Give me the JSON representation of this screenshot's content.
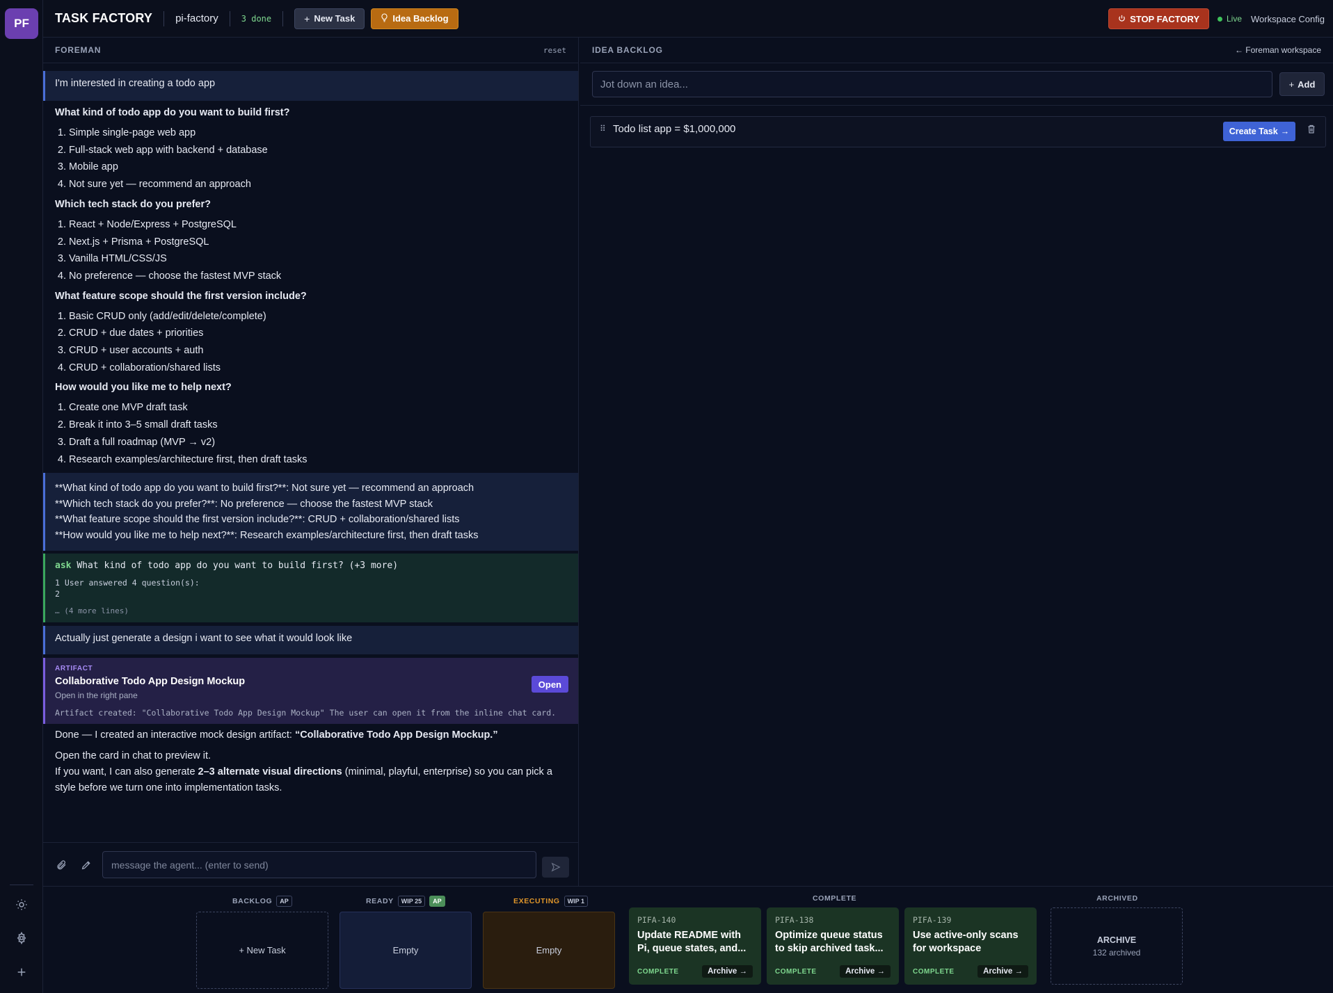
{
  "rail": {
    "avatar": "PF",
    "icons": [
      "sun-icon",
      "gear-icon",
      "plus-icon"
    ]
  },
  "header": {
    "brand": "TASK FACTORY",
    "project": "pi-factory",
    "done": "3 done",
    "new_task": "New Task",
    "idea_backlog": "Idea Backlog",
    "stop": "STOP FACTORY",
    "live": "Live",
    "workspace_config": "Workspace Config"
  },
  "foreman": {
    "title": "FOREMAN",
    "reset": "reset",
    "user_msg_1": "I'm interested in creating a todo app",
    "questions": [
      {
        "q": "What kind of todo app do you want to build first?",
        "opts": [
          "Simple single-page web app",
          "Full-stack web app with backend + database",
          "Mobile app",
          "Not sure yet — recommend an approach"
        ]
      },
      {
        "q": "Which tech stack do you prefer?",
        "opts": [
          "React + Node/Express + PostgreSQL",
          "Next.js + Prisma + PostgreSQL",
          "Vanilla HTML/CSS/JS",
          "No preference — choose the fastest MVP stack"
        ]
      },
      {
        "q": "What feature scope should the first version include?",
        "opts": [
          "Basic CRUD only (add/edit/delete/complete)",
          "CRUD + due dates + priorities",
          "CRUD + user accounts + auth",
          "CRUD + collaboration/shared lists"
        ]
      },
      {
        "q": "How would you like me to help next?",
        "opts": [
          "Create one MVP draft task",
          "Break it into 3–5 small draft tasks",
          "Draft a full roadmap (MVP → v2)",
          "Research examples/architecture first, then draft tasks"
        ]
      }
    ],
    "answers": [
      "**What kind of todo app do you want to build first?**: Not sure yet — recommend an approach",
      "**Which tech stack do you prefer?**: No preference — choose the fastest MVP stack",
      "**What feature scope should the first version include?**: CRUD + collaboration/shared lists",
      "**How would you like me to help next?**: Research examples/architecture first, then draft tasks"
    ],
    "tool": {
      "name": "ask",
      "summary": "What kind of todo app do you want to build first? (+3 more)",
      "line1": "1  User answered 4 question(s):",
      "line2": "2",
      "more": "… (4 more lines)"
    },
    "user_msg_2": "Actually just generate a design i want to see what it would look like",
    "artifact": {
      "label": "ARTIFACT",
      "title": "Collaborative Todo App Design Mockup",
      "sub": "Open in the right pane",
      "open": "Open",
      "log": "Artifact created: \"Collaborative Todo App Design Mockup\" The user can open it from the inline chat card."
    },
    "final": {
      "p1_prefix": "Done — I created an interactive mock design artifact: ",
      "p1_bold": "“Collaborative Todo App Design Mockup.”",
      "p2": "Open the card in chat to preview it.",
      "p3_prefix": "If you want, I can also generate ",
      "p3_bold": "2–3 alternate visual directions",
      "p3_suffix": " (minimal, playful, enterprise) so you can pick a style before we turn one into implementation tasks."
    },
    "composer_placeholder": "message the agent... (enter to send)"
  },
  "ideas": {
    "title": "IDEA BACKLOG",
    "back": "Foreman workspace",
    "input_placeholder": "Jot down an idea...",
    "add": "Add",
    "items": [
      {
        "text": "Todo list app = $1,000,000",
        "create": "Create Task"
      }
    ]
  },
  "board": {
    "backlog": {
      "label": "BACKLOG",
      "tag": "AP",
      "slot": "+ New Task"
    },
    "ready": {
      "label": "READY",
      "tag1": "WIP 25",
      "tag2": "AP",
      "slot": "Empty"
    },
    "executing": {
      "label": "EXECUTING",
      "tag": "WIP 1",
      "slot": "Empty"
    },
    "complete": {
      "label": "COMPLETE",
      "cards": [
        {
          "id": "PIFA-140",
          "title": "Update README with Pi, queue states, and...",
          "status": "COMPLETE",
          "action": "Archive"
        },
        {
          "id": "PIFA-138",
          "title": "Optimize queue status to skip archived task...",
          "status": "COMPLETE",
          "action": "Archive"
        },
        {
          "id": "PIFA-139",
          "title": "Use active-only scans for workspace attentio...",
          "status": "COMPLETE",
          "action": "Archive"
        }
      ]
    },
    "archived": {
      "label": "ARCHIVED",
      "title": "ARCHIVE",
      "count": "132 archived"
    }
  },
  "colors": {
    "accent": "#4a6fd8",
    "stop": "#a8331d",
    "idea": "#b86b12",
    "complete_card": "#1b3424"
  }
}
